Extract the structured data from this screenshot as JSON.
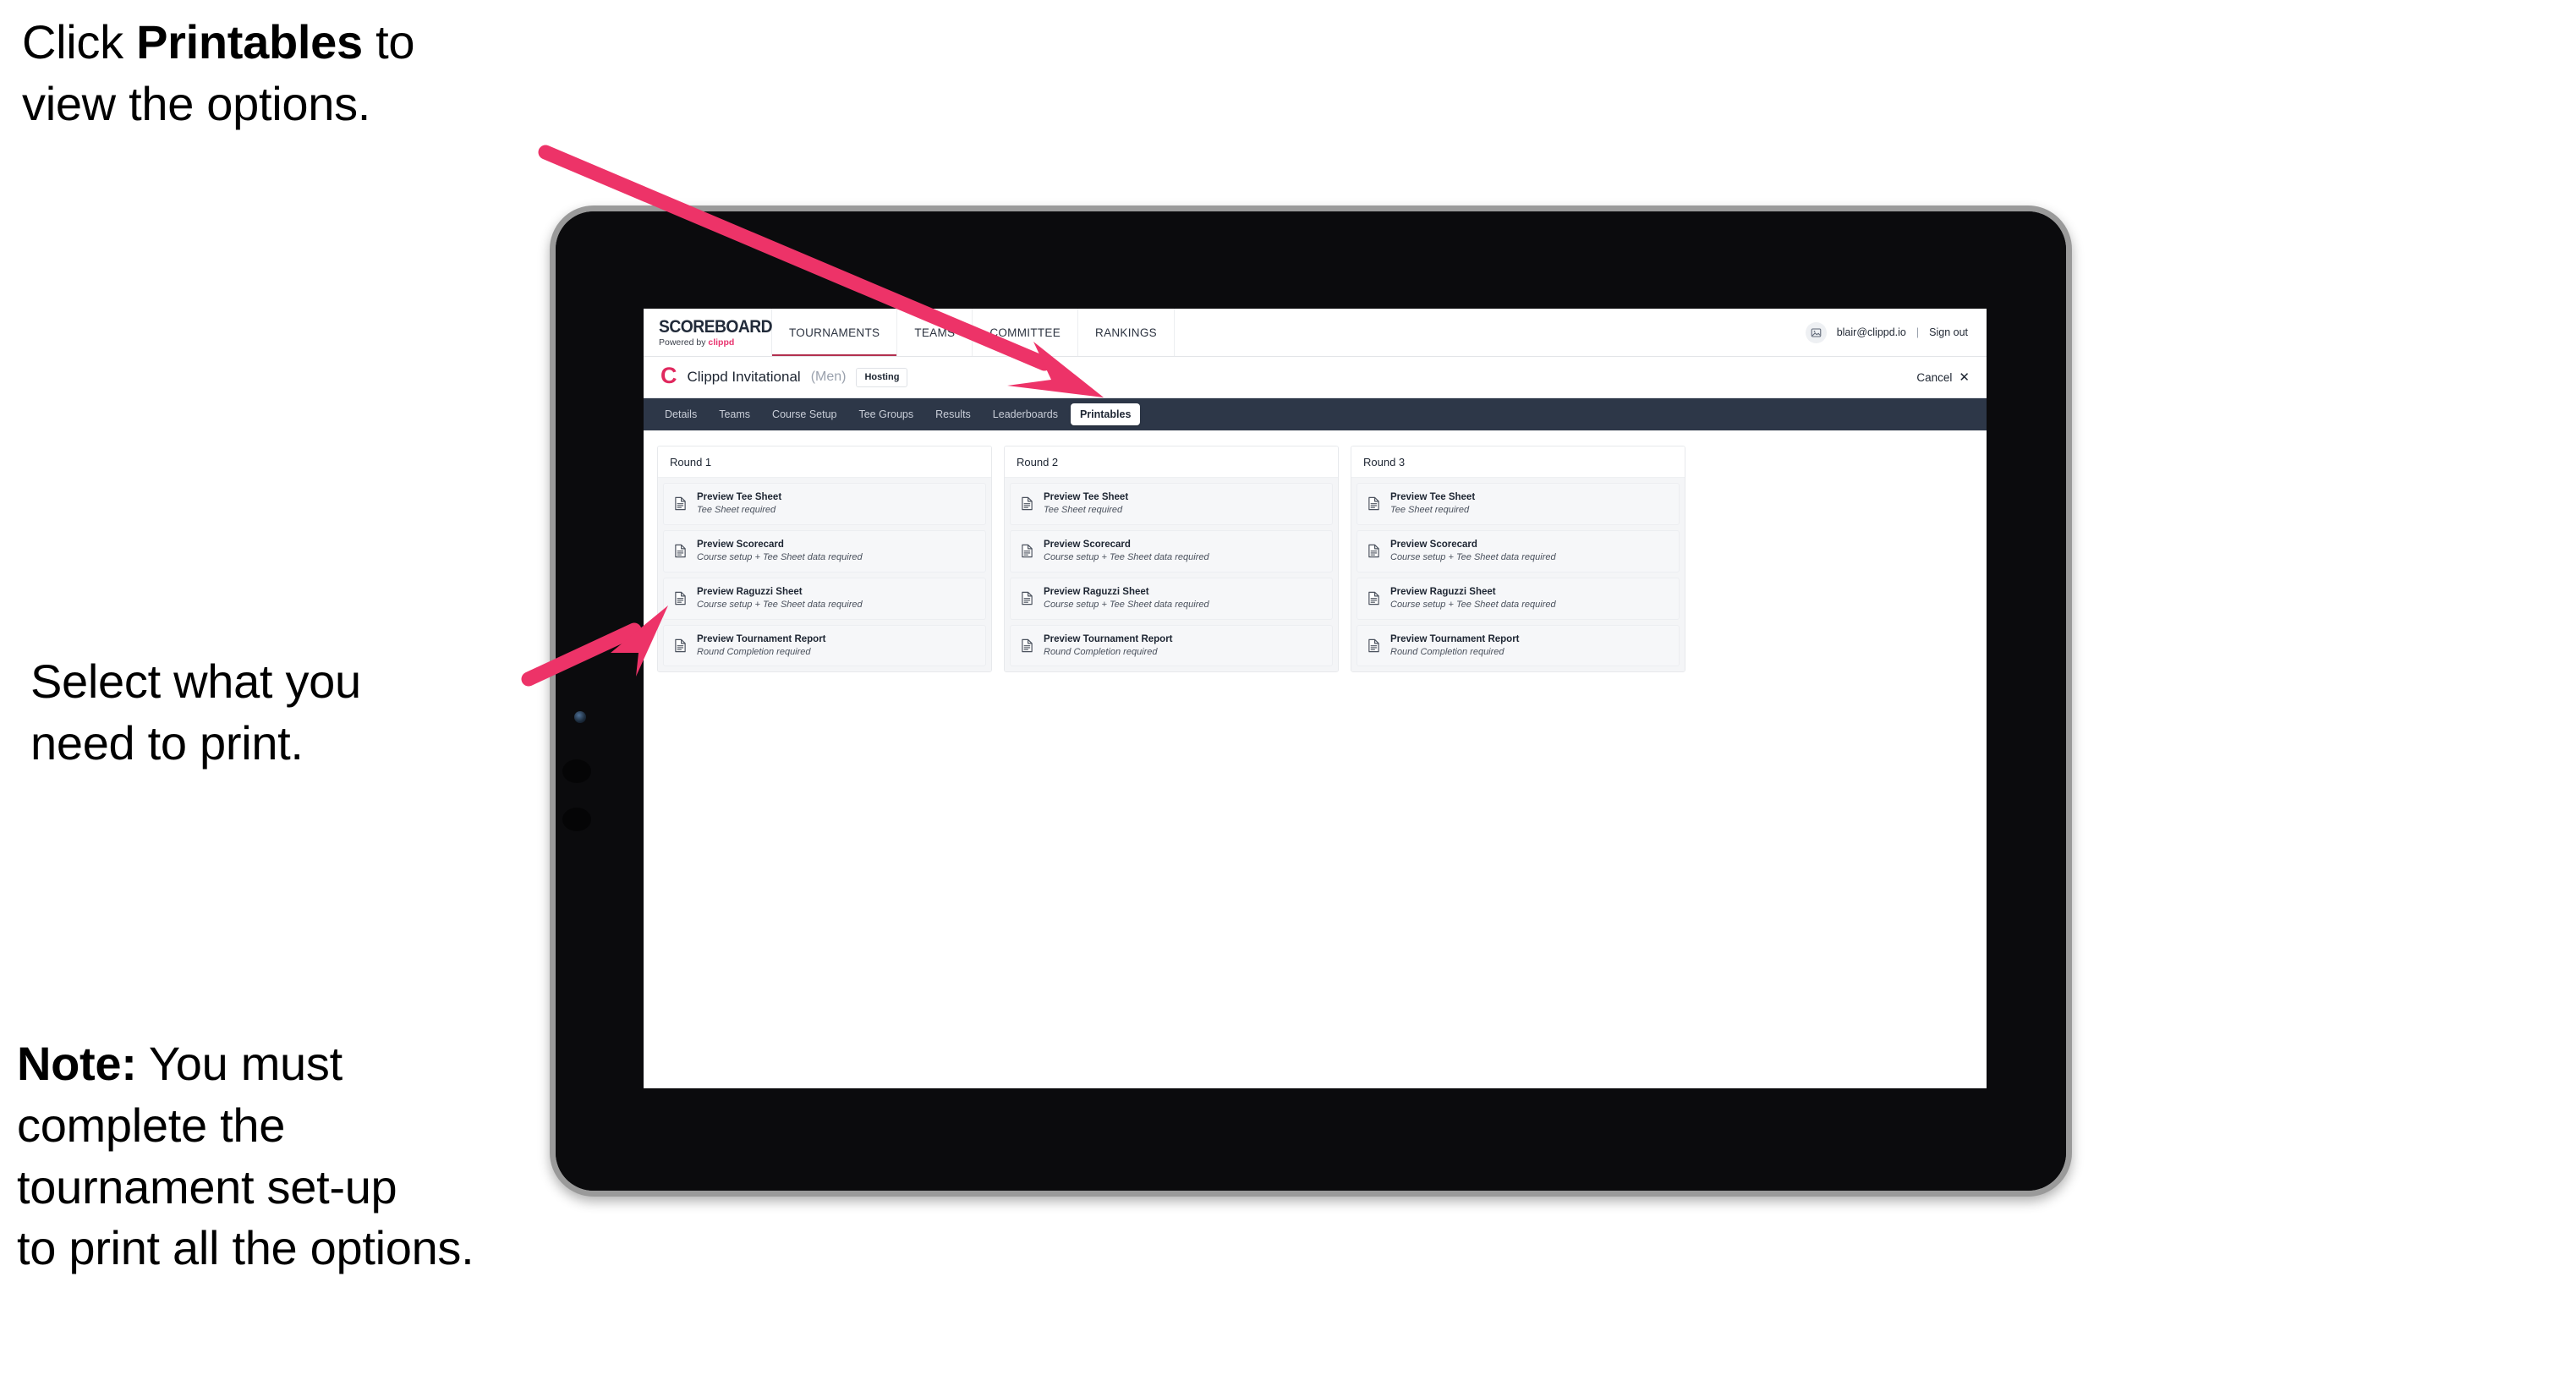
{
  "annotations": {
    "click_printables": "Click Printables to\nview the options.",
    "click_printables_pre": "Click ",
    "click_printables_bold": "Printables",
    "click_printables_post": " to\nview the options.",
    "select_print": "Select what you\n need to print.",
    "note_pre": "Note:",
    "note_body": " You must\ncomplete the\ntournament set-up\nto print all the options."
  },
  "colors": {
    "arrow_pink": "#ed3368",
    "brand_pink": "#e8336e",
    "tab_bar": "#2d3748",
    "nav_underline": "#b2304f"
  },
  "app": {
    "logo": {
      "wordmark": "SCOREBOARD",
      "powered_by": "Powered by ",
      "brand": "clippd"
    },
    "nav": [
      {
        "label": "TOURNAMENTS",
        "active": true
      },
      {
        "label": "TEAMS",
        "active": false
      },
      {
        "label": "COMMITTEE",
        "active": false
      },
      {
        "label": "RANKINGS",
        "active": false
      }
    ],
    "user": {
      "avatar_icon": "user-image-icon",
      "email": "blair@clippd.io",
      "separator": "|",
      "sign_out": "Sign out"
    },
    "tournament": {
      "logo_letter": "C",
      "name": "Clippd Invitational",
      "gender": "(Men)",
      "status_badge": "Hosting",
      "cancel_label": "Cancel",
      "cancel_icon": "✕"
    },
    "tabs": [
      {
        "label": "Details",
        "active": false
      },
      {
        "label": "Teams",
        "active": false
      },
      {
        "label": "Course Setup",
        "active": false
      },
      {
        "label": "Tee Groups",
        "active": false
      },
      {
        "label": "Results",
        "active": false
      },
      {
        "label": "Leaderboards",
        "active": false
      },
      {
        "label": "Printables",
        "active": true
      }
    ],
    "rounds": [
      {
        "title": "Round 1",
        "items": [
          {
            "title": "Preview Tee Sheet",
            "sub": "Tee Sheet required"
          },
          {
            "title": "Preview Scorecard",
            "sub": "Course setup + Tee Sheet data required"
          },
          {
            "title": "Preview Raguzzi Sheet",
            "sub": "Course setup + Tee Sheet data required"
          },
          {
            "title": "Preview Tournament Report",
            "sub": "Round Completion required"
          }
        ]
      },
      {
        "title": "Round 2",
        "items": [
          {
            "title": "Preview Tee Sheet",
            "sub": "Tee Sheet required"
          },
          {
            "title": "Preview Scorecard",
            "sub": "Course setup + Tee Sheet data required"
          },
          {
            "title": "Preview Raguzzi Sheet",
            "sub": "Course setup + Tee Sheet data required"
          },
          {
            "title": "Preview Tournament Report",
            "sub": "Round Completion required"
          }
        ]
      },
      {
        "title": "Round 3",
        "items": [
          {
            "title": "Preview Tee Sheet",
            "sub": "Tee Sheet required"
          },
          {
            "title": "Preview Scorecard",
            "sub": "Course setup + Tee Sheet data required"
          },
          {
            "title": "Preview Raguzzi Sheet",
            "sub": "Course setup + Tee Sheet data required"
          },
          {
            "title": "Preview Tournament Report",
            "sub": "Round Completion required"
          }
        ]
      }
    ]
  }
}
